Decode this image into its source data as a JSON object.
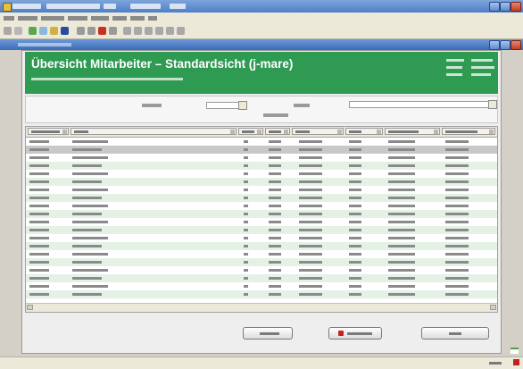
{
  "header": {
    "title": "Übersicht Mitarbeiter  –  Standardsicht (j-mare)",
    "accent_color": "#2e9a52"
  },
  "table": {
    "row_fill_alt": "#e4f2e6",
    "row_fill_selected": "#c8c8c8",
    "selected_row_index": 1,
    "row_count": 20
  },
  "icons": {
    "window": "app-icon",
    "minimize": "minimize-icon",
    "maximize": "maximize-icon",
    "close": "close-icon",
    "delete_button": "red-square-icon",
    "status_close": "red-x-icon"
  }
}
